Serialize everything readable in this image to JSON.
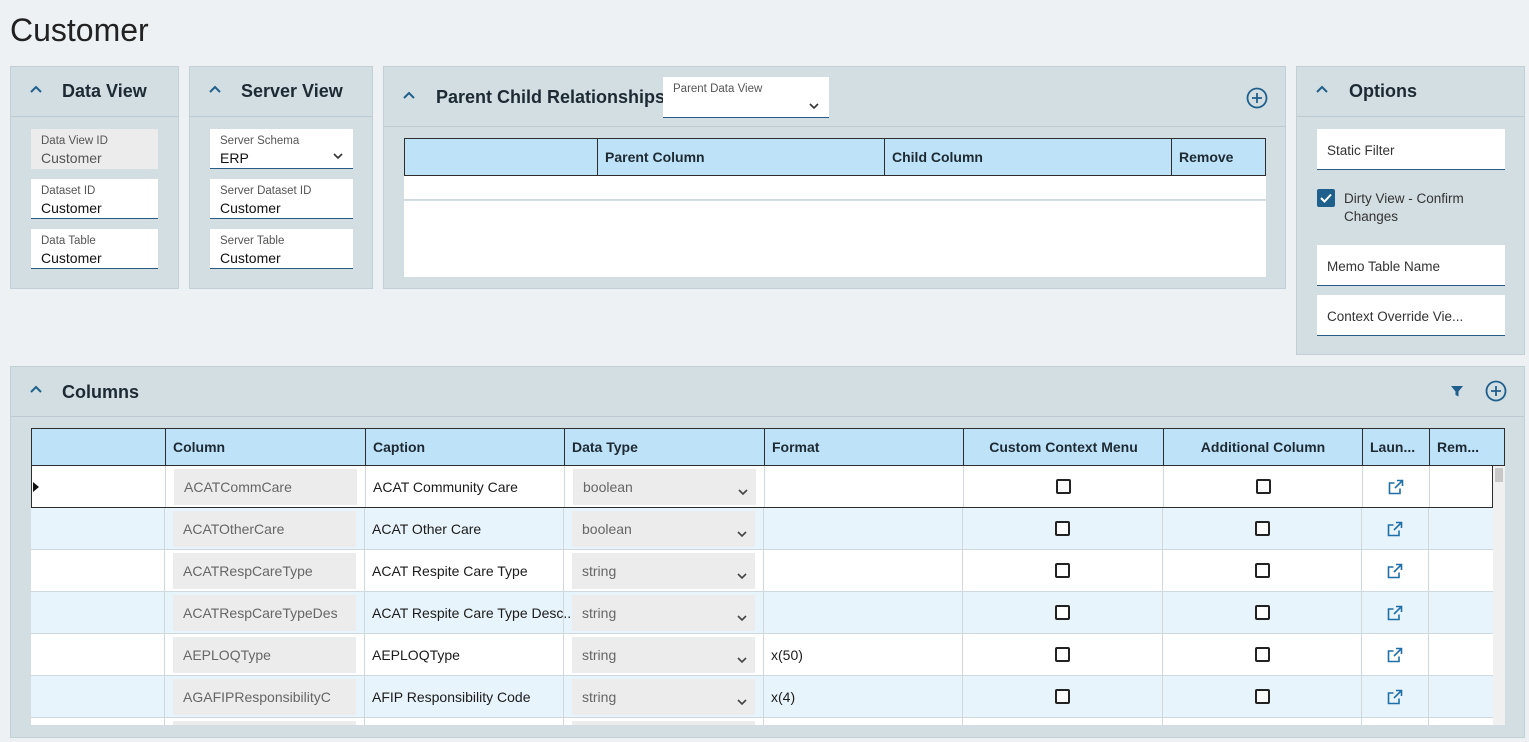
{
  "page_title": "Customer",
  "data_view": {
    "title": "Data View",
    "fields": [
      {
        "label": "Data View ID",
        "value": "Customer"
      },
      {
        "label": "Dataset ID",
        "value": "Customer"
      },
      {
        "label": "Data Table",
        "value": "Customer"
      }
    ]
  },
  "server_view": {
    "title": "Server View",
    "fields": [
      {
        "label": "Server Schema",
        "value": "ERP"
      },
      {
        "label": "Server Dataset ID",
        "value": "Customer"
      },
      {
        "label": "Server Table",
        "value": "Customer"
      }
    ]
  },
  "parent_child": {
    "title": "Parent Child Relationships",
    "parent_data_view_label": "Parent Data View",
    "parent_data_view_value": "",
    "columns": [
      "",
      "Parent Column",
      "Child Column",
      "Remove"
    ]
  },
  "options": {
    "title": "Options",
    "static_filter_placeholder": "Static Filter",
    "dirty_view_label": "Dirty View - Confirm Changes",
    "dirty_view_checked": true,
    "memo_table_placeholder": "Memo Table Name",
    "context_override_placeholder": "Context Override Vie..."
  },
  "columns_panel": {
    "title": "Columns",
    "headers": [
      "",
      "Column",
      "Caption",
      "Data Type",
      "Format",
      "Custom Context Menu",
      "Additional Column",
      "Laun...",
      "Rem..."
    ],
    "rows": [
      {
        "column": "ACATCommCare",
        "caption": "ACAT Community Care",
        "data_type": "boolean",
        "format": "",
        "custom_context_menu": false,
        "additional_column": false
      },
      {
        "column": "ACATOtherCare",
        "caption": "ACAT Other Care",
        "data_type": "boolean",
        "format": "",
        "custom_context_menu": false,
        "additional_column": false
      },
      {
        "column": "ACATRespCareType",
        "caption": "ACAT Respite Care Type",
        "data_type": "string",
        "format": "",
        "custom_context_menu": false,
        "additional_column": false
      },
      {
        "column": "ACATRespCareTypeDes",
        "caption": "ACAT Respite Care Type Desc...",
        "data_type": "string",
        "format": "",
        "custom_context_menu": false,
        "additional_column": false
      },
      {
        "column": "AEPLOQType",
        "caption": "AEPLOQType",
        "data_type": "string",
        "format": "x(50)",
        "custom_context_menu": false,
        "additional_column": false
      },
      {
        "column": "AGAFIPResponsibilityC",
        "caption": "AFIP Responsibility Code",
        "data_type": "string",
        "format": "x(4)",
        "custom_context_menu": false,
        "additional_column": false
      }
    ]
  },
  "colors": {
    "accent": "#1f5f8b",
    "panel_bg": "#d3dee3",
    "header_bg": "#bee2f7",
    "alt_row_bg": "#e8f4fb"
  }
}
